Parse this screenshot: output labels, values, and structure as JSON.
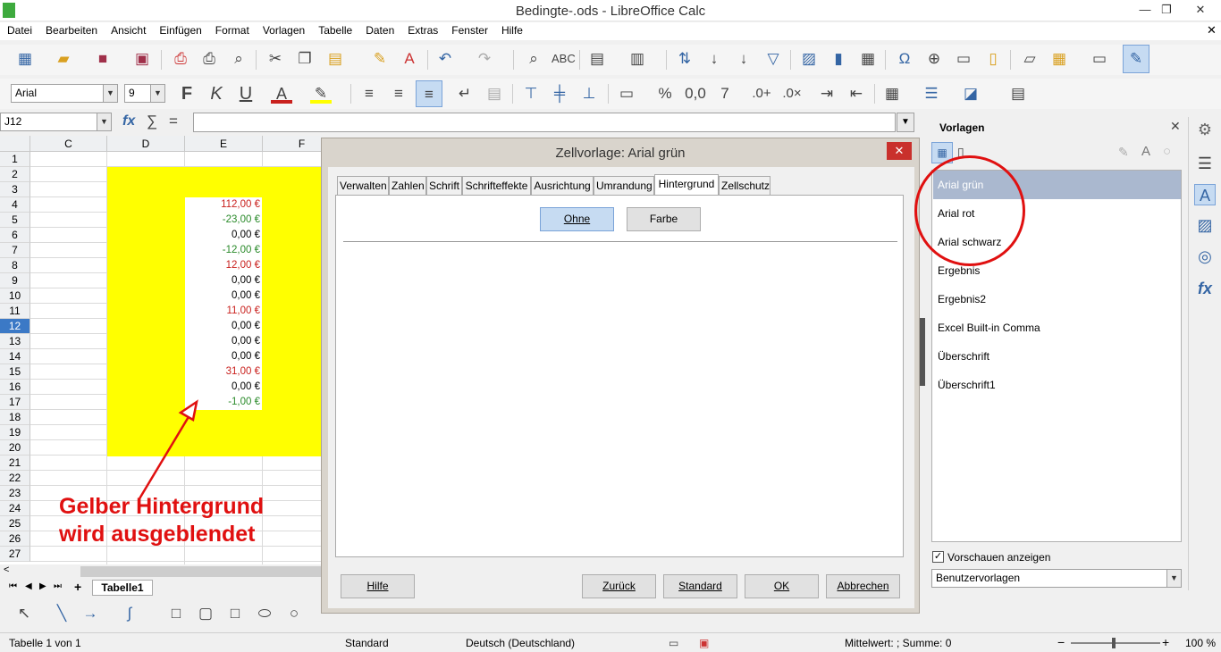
{
  "window": {
    "title": "Bedingte-.ods - LibreOffice Calc"
  },
  "menu": [
    "Datei",
    "Bearbeiten",
    "Ansicht",
    "Einfügen",
    "Format",
    "Vorlagen",
    "Tabelle",
    "Daten",
    "Extras",
    "Fenster",
    "Hilfe"
  ],
  "font": {
    "name": "Arial",
    "size": "9"
  },
  "namebox": "J12",
  "formula_symbols": {
    "fx": "fx",
    "sum": "∑",
    "eq": "="
  },
  "columns": [
    "C",
    "D",
    "E",
    "F"
  ],
  "rows": [
    "1",
    "2",
    "3",
    "4",
    "5",
    "6",
    "7",
    "8",
    "9",
    "10",
    "11",
    "12",
    "13",
    "14",
    "15",
    "16",
    "17",
    "18",
    "19",
    "20",
    "21",
    "22",
    "23",
    "24",
    "25",
    "26",
    "27"
  ],
  "cells": [
    {
      "row": 4,
      "value": "112,00 €",
      "color": "red"
    },
    {
      "row": 5,
      "value": "-23,00 €",
      "color": "green"
    },
    {
      "row": 6,
      "value": "0,00 €",
      "color": "blk"
    },
    {
      "row": 7,
      "value": "-12,00 €",
      "color": "green"
    },
    {
      "row": 8,
      "value": "12,00 €",
      "color": "red"
    },
    {
      "row": 9,
      "value": "0,00 €",
      "color": "blk"
    },
    {
      "row": 10,
      "value": "0,00 €",
      "color": "blk"
    },
    {
      "row": 11,
      "value": "11,00 €",
      "color": "red"
    },
    {
      "row": 12,
      "value": "0,00 €",
      "color": "blk"
    },
    {
      "row": 13,
      "value": "0,00 €",
      "color": "blk"
    },
    {
      "row": 14,
      "value": "0,00 €",
      "color": "blk"
    },
    {
      "row": 15,
      "value": "31,00 €",
      "color": "red"
    },
    {
      "row": 16,
      "value": "0,00 €",
      "color": "blk"
    },
    {
      "row": 17,
      "value": "-1,00 €",
      "color": "green"
    }
  ],
  "annotation": {
    "line1": "Gelber Hintergrund",
    "line2": "wird ausgeblendet"
  },
  "sheet_tab": "Tabelle1",
  "dialog": {
    "title": "Zellvorlage: Arial grün",
    "tabs": [
      "Verwalten",
      "Zahlen",
      "Schrift",
      "Schrifteffekte",
      "Ausrichtung",
      "Umrandung",
      "Hintergrund",
      "Zellschutz"
    ],
    "active_tab": "Hintergrund",
    "bg_none": "Ohne",
    "bg_color": "Farbe",
    "buttons": {
      "help": "Hilfe",
      "back": "Zurück",
      "standard": "Standard",
      "ok": "OK",
      "cancel": "Abbrechen"
    }
  },
  "sidebar": {
    "title": "Vorlagen",
    "styles": [
      "Arial grün",
      "Arial rot",
      "Arial schwarz",
      "Ergebnis",
      "Ergebnis2",
      "Excel Built-in Comma",
      "Überschrift",
      "Überschrift1"
    ],
    "preview_label": "Vorschauen anzeigen",
    "filter": "Benutzervorlagen"
  },
  "status": {
    "sheet": "Tabelle 1 von 1",
    "style": "Standard",
    "lang": "Deutsch (Deutschland)",
    "summary": "Mittelwert: ; Summe: 0",
    "zoom": "100 %"
  },
  "colors": {
    "yellow": "#ffff00",
    "accent": "#3465a4",
    "annotation": "#e01010",
    "selected_style": "#aab8cf"
  }
}
